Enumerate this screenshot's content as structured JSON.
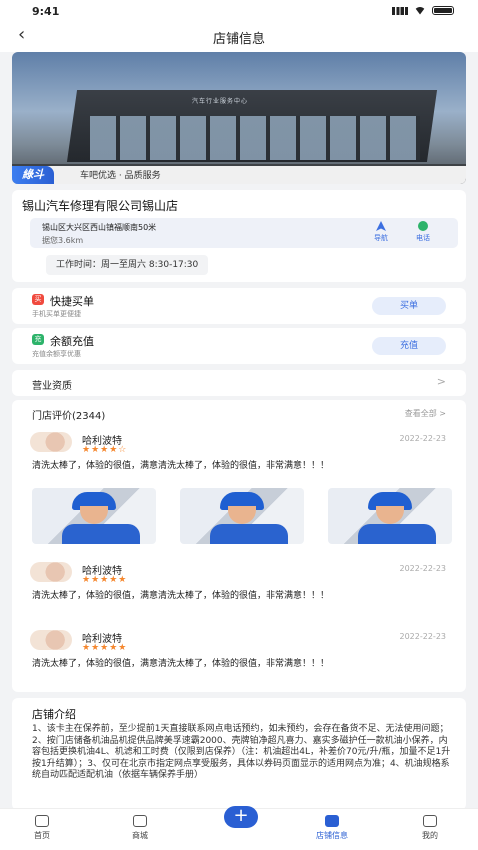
{
  "status_bar": {
    "time": "9:41"
  },
  "nav": {
    "back_icon": "‹",
    "title": "店铺信息"
  },
  "banner": {
    "sign_text": "汽车行业服务中心",
    "tag": "綠斗",
    "tag_text": "车吧优选 · 品质服务"
  },
  "store": {
    "name": "锡山汽车修理有限公司锡山店",
    "address": "锡山区大兴区西山镇福顺南50米",
    "distance": "据您3.6km",
    "nav_label": "导航",
    "call_label": "电话",
    "hours": "工作时间：周一至周六 8:30-17:30"
  },
  "quick_buy": {
    "icon_text": "买",
    "title": "快捷买单",
    "subtitle": "手机买单更便捷",
    "button": "买单",
    "icon_color": "#f04a3e"
  },
  "recharge": {
    "icon_text": "充",
    "title": "余额充值",
    "subtitle": "充值余额享优惠",
    "button": "充值",
    "icon_color": "#2db36a"
  },
  "qualification": {
    "label": "营业资质",
    "chevron": ">"
  },
  "reviews": {
    "header": "门店评价(2344)",
    "see_all": "查看全部 >",
    "items": [
      {
        "name": "哈利波特",
        "stars": "★★★★☆",
        "date": "2022-22-23",
        "text": "清洗太棒了，体验的很值，满意清洗太棒了，体验的很值，非常满意！！！"
      },
      {
        "name": "哈利波特",
        "stars": "★★★★★",
        "date": "2022-22-23",
        "text": "清洗太棒了，体验的很值，满意清洗太棒了，体验的很值，非常满意！！！"
      },
      {
        "name": "哈利波特",
        "stars": "★★★★★",
        "date": "2022-22-23",
        "text": "清洗太棒了，体验的很值，满意清洗太棒了，体验的很值，非常满意！！！"
      }
    ]
  },
  "intro": {
    "title": "店铺介绍",
    "text": "1、该卡主在保养前，至少提前1天直接联系网点电话预约，如未预约，会存在备货不足、无法使用问题；2、按门店储备机油品机提供品牌美孚速霸2000、壳牌铂净超凡喜力、嘉实多磁护任一款机油小保养，内容包括更换机油4L、机滤和工时费（仅限到店保养）（注：机油超出4L，补差价70元/升/瓶，加量不足1升按1升结算）；3、仅可在北京市指定网点享受服务，具体以券码页面显示的适用网点为准；4、机油规格系统自动匹配适配机油（依据车辆保养手册）"
  },
  "tabbar": {
    "items": [
      {
        "label": "首页"
      },
      {
        "label": "商城"
      },
      {
        "label": "店铺信息"
      },
      {
        "label": "我的"
      }
    ],
    "plus": "+",
    "active_color": "#2a5fd3"
  }
}
